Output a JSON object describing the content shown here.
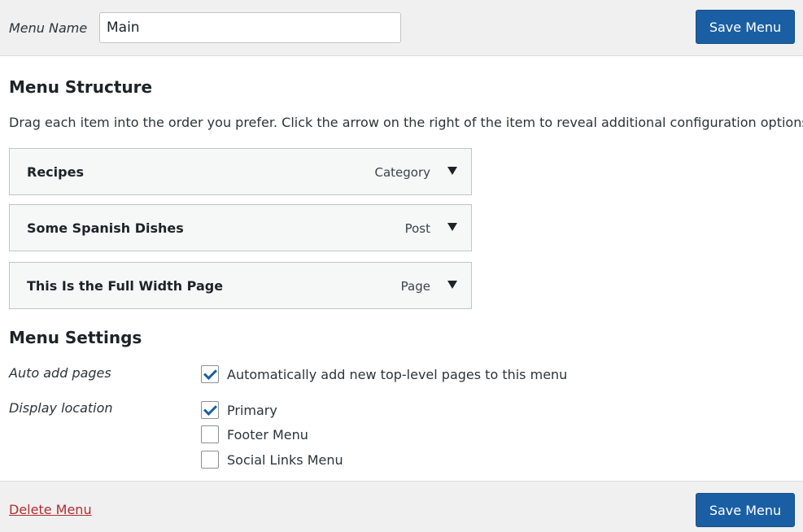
{
  "header": {
    "menu_name_label": "Menu Name",
    "menu_name_value": "Main",
    "save_label": "Save Menu"
  },
  "structure": {
    "title": "Menu Structure",
    "instructions": "Drag each item into the order you prefer. Click the arrow on the right of the item to reveal additional configuration options.",
    "items": [
      {
        "title": "Recipes",
        "type": "Category",
        "icon": "caret-down-icon"
      },
      {
        "title": "Some Spanish Dishes",
        "type": "Post",
        "icon": "caret-down-icon"
      },
      {
        "title": "This Is the Full Width Page",
        "type": "Page",
        "icon": "caret-down-icon"
      }
    ]
  },
  "settings": {
    "title": "Menu Settings",
    "auto_add": {
      "label": "Auto add pages",
      "option": {
        "label": "Automatically add new top-level pages to this menu",
        "checked": true
      }
    },
    "display_location": {
      "label": "Display location",
      "options": [
        {
          "label": "Primary",
          "checked": true
        },
        {
          "label": "Footer Menu",
          "checked": false
        },
        {
          "label": "Social Links Menu",
          "checked": false
        }
      ]
    }
  },
  "footer": {
    "delete_label": "Delete Menu",
    "save_label": "Save Menu"
  },
  "colors": {
    "primary_button": "#1a5fa3",
    "delete_link": "#b32d2e",
    "bar_background": "#f0f0f1"
  }
}
